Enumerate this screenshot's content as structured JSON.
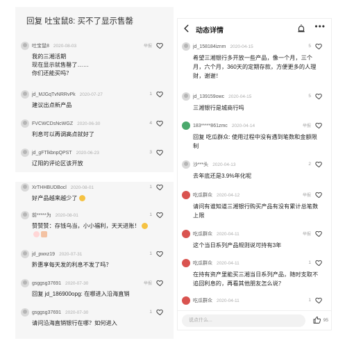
{
  "left_top": {
    "top_reply": "回复 吐宝鼠8: 买不了显示售罄",
    "comments": [
      {
        "name": "吐宝鼠8",
        "time": "2020-08-03",
        "report": "举报",
        "likes": "",
        "lines": [
          "我的三湘活期",
          "现在显示就售罄了……",
          "你们还能买吗？"
        ]
      },
      {
        "name": "jd_MJGqTvNRRvPk",
        "time": "2020-07-27",
        "report": "",
        "likes": "1",
        "lines": [
          "建议出点新产品"
        ]
      },
      {
        "name": "FVCWCDsNcWGZ",
        "time": "2020-06-30",
        "report": "",
        "likes": "4",
        "lines": [
          "利息可以再调高点就好了"
        ]
      },
      {
        "name": "jd_gFTlkbnpQPST",
        "time": "2020-06-23",
        "report": "",
        "likes": "3",
        "lines": [
          "辽阳的评论区该开放"
        ]
      }
    ]
  },
  "left_bottom": {
    "comments": [
      {
        "name": "XrTHHBUDBocl",
        "time": "2020-08-01",
        "report": "",
        "likes": "1",
        "lines": [
          "好产品越来越少了"
        ]
      },
      {
        "name": "前*****为",
        "time": "2020-08-01",
        "report": "",
        "likes": "1",
        "lines": [
          "赞赞赞：存钱乌当，小小福利，天天进账！",
          ""
        ]
      },
      {
        "name": "jd_pwxz19",
        "time": "2020-07-31",
        "report": "",
        "likes": "1",
        "lines": [
          "黔惠享每天发的利息不发了吗？"
        ]
      },
      {
        "name": "gsggsg37691",
        "time": "2020-07-30",
        "report": "举报",
        "likes": "",
        "lines": [
          "回复 jd_186900opg: 在哪进入沿海直销"
        ]
      },
      {
        "name": "gsggsg37691",
        "time": "2020-07-30",
        "report": "",
        "likes": "1",
        "lines": [
          "请问沿海直销银行在哪？如何进入"
        ]
      }
    ]
  },
  "right": {
    "title": "动态详情",
    "more": "•••",
    "comments": [
      {
        "name": "jd_158184iznm",
        "time": "2020-04-15",
        "report": "",
        "likes": "5",
        "lines": [
          "希望三湘银行多开放一些产品，像一个月，三个",
          "月，六个月，360天的定期存款，方便更多的人理",
          "财，谢谢！"
        ]
      },
      {
        "name": "jd_139159owc",
        "time": "2020-04-15",
        "report": "",
        "likes": "5",
        "lines": [
          "三湘银行是城商行吗"
        ]
      },
      {
        "name": "183*****861zmc",
        "time": "2020-04-14",
        "report": "举报",
        "likes": "",
        "lines": [
          "回复 吃瓜群众: 使用过程中没有遇到笔数和金额限",
          "制"
        ]
      },
      {
        "name": "沙***头",
        "time": "2020-04-13",
        "report": "",
        "likes": "2",
        "lines": [
          "去年底还是3.9%年化呢"
        ]
      },
      {
        "name": "吃瓜群众",
        "time": "2020-04-12",
        "report": "举报",
        "likes": "",
        "lines": [
          "请问有谁知道三湘银行购买产品有没有累计总笔数",
          "上限"
        ]
      },
      {
        "name": "吃瓜群众",
        "time": "2020-04-11",
        "report": "举报",
        "likes": "",
        "lines": [
          "这个当日系列产品规则说可持有3年"
        ]
      },
      {
        "name": "吃瓜群众",
        "time": "2020-04-11",
        "report": "",
        "likes": "1",
        "lines": [
          "在持有资产里能买三湘当日系列产品，随时支取不",
          "追回利息的，再看其他朋友怎么说？"
        ]
      },
      {
        "name": "吃瓜群众",
        "time": "2020-04-11",
        "report": "",
        "likes": "1",
        "lines": [
          ""
        ]
      }
    ],
    "input_placeholder": "说点什么...",
    "thumb_count": "95"
  }
}
